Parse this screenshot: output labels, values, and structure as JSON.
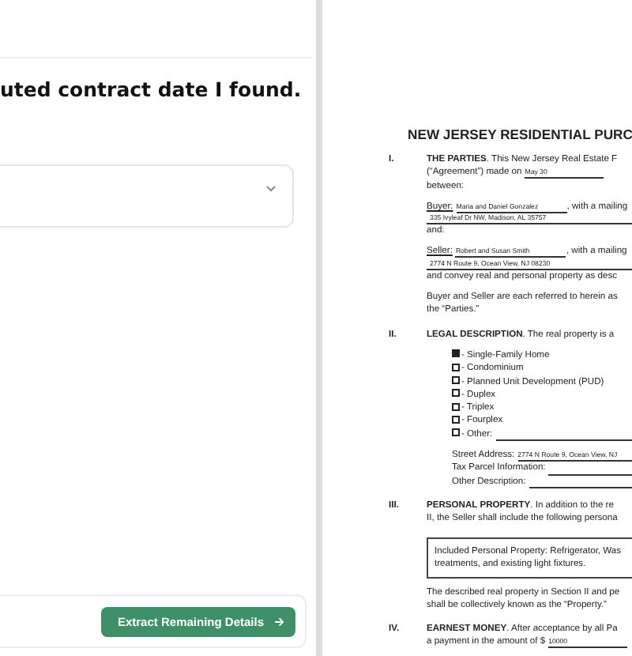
{
  "chat": {
    "heading": "uted contract date I found.",
    "button": "Extract Remaining Details"
  },
  "document": {
    "title": "NEW JERSEY RESIDENTIAL PURC",
    "sections": [
      {
        "numeral": "I.",
        "paragraphs": [
          {
            "kind": "text",
            "lines": [
              {
                "text": "**THE PARTIES**. This New Jersey Real Estate F"
              },
              {
                "text": "(“Agreement”) made on",
                "value": "May 30"
              },
              {
                "text": "between:"
              }
            ]
          },
          {
            "kind": "party",
            "label": "Buyer:",
            "value": "Maria and Daniel Gonzalez",
            "tail": ", with a mailing",
            "address": "335 Ivyleaf Dr NW, Madison, AL 35757",
            "after": "and:"
          },
          {
            "kind": "party",
            "label": "Seller:",
            "value": "Robert and Susan Smith",
            "tail": ", with a mailing",
            "address": "2774 N Route 9, Ocean View, NJ 08230",
            "after": "and convey real and personal property as desc"
          },
          {
            "kind": "text",
            "lines": [
              {
                "text": "Buyer and Seller are each referred to herein as"
              },
              {
                "text": "the “Parties.”"
              }
            ]
          }
        ]
      },
      {
        "numeral": "II.",
        "paragraphs": [
          {
            "kind": "text",
            "lines": [
              {
                "text": "**LEGAL DESCRIPTION**. The real property is a"
              }
            ]
          },
          {
            "kind": "checklist",
            "items": [
              {
                "label": "- Single-Family Home",
                "checked": true,
                "blank": false
              },
              {
                "label": "- Condominium",
                "checked": false,
                "blank": false
              },
              {
                "label": "- Planned Unit Development (PUD)",
                "checked": false,
                "blank": false
              },
              {
                "label": "- Duplex",
                "checked": false,
                "blank": false
              },
              {
                "label": "- Triplex",
                "checked": false,
                "blank": false
              },
              {
                "label": "- Fourplex",
                "checked": false,
                "blank": false
              },
              {
                "label": "- Other:",
                "checked": false,
                "blank": true
              }
            ]
          },
          {
            "kind": "fields",
            "items": [
              {
                "label": "Street Address:",
                "value": "2774 N Route 9, Ocean View, NJ"
              },
              {
                "label": "Tax Parcel Information:"
              },
              {
                "label": "Other Description:"
              }
            ]
          }
        ]
      },
      {
        "numeral": "III.",
        "paragraphs": [
          {
            "kind": "text",
            "lines": [
              {
                "text": "**PERSONAL PROPERTY**. In addition to the re"
              },
              {
                "text": "II, the Seller shall include the following persona"
              }
            ]
          },
          {
            "kind": "box",
            "lines": [
              "Included Personal Property: Refrigerator, Was",
              "treatments, and existing light fixtures."
            ]
          },
          {
            "kind": "text",
            "lines": [
              {
                "text": "The described real property in Section II and pe"
              },
              {
                "text": "shall be collectively known as the “Property.”"
              }
            ]
          }
        ]
      },
      {
        "numeral": "IV.",
        "paragraphs": [
          {
            "kind": "text",
            "lines": [
              {
                "text": "**EARNEST MONEY**. After acceptance by all Pa"
              },
              {
                "text": "a payment in the amount of $",
                "value": "10000"
              }
            ]
          }
        ]
      }
    ]
  }
}
